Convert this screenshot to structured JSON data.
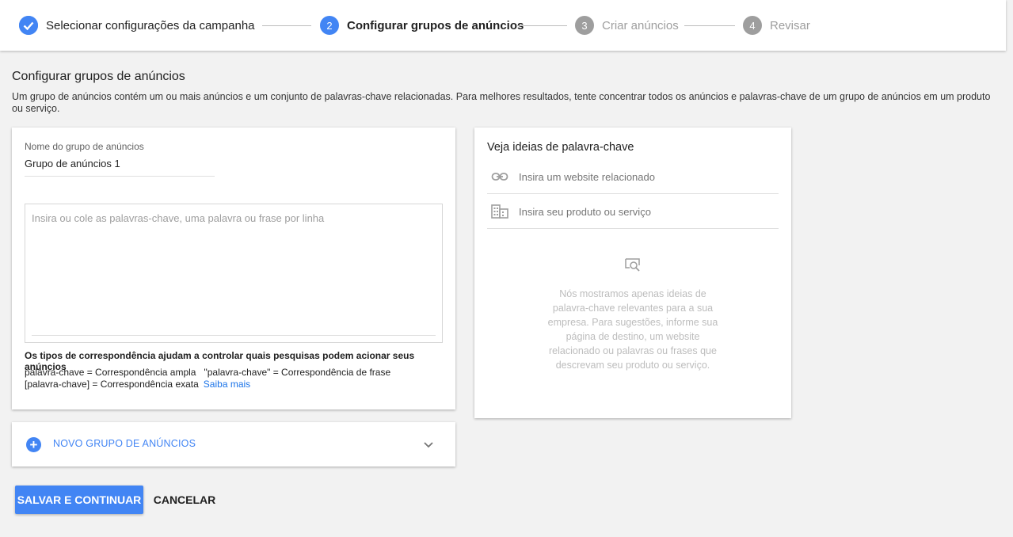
{
  "stepper": {
    "steps": [
      {
        "num": "",
        "label": "Selecionar configurações da campanha",
        "state": "done"
      },
      {
        "num": "2",
        "label": "Configurar grupos de anúncios",
        "state": "active"
      },
      {
        "num": "3",
        "label": "Criar anúncios",
        "state": "todo"
      },
      {
        "num": "4",
        "label": "Revisar",
        "state": "todo"
      }
    ]
  },
  "page": {
    "title": "Configurar grupos de anúncios",
    "description": "Um grupo de anúncios contém um ou mais anúncios e um conjunto de palavras-chave relacionadas. Para melhores resultados, tente concentrar todos os anúncios e palavras-chave de um grupo de anúncios em um produto ou serviço."
  },
  "ad_group": {
    "name_label": "Nome do grupo de anúncios",
    "name_value": "Grupo de anúncios 1",
    "keywords_placeholder": "Insira ou cole as palavras-chave, uma palavra ou frase por linha",
    "match_title": "Os tipos de correspondência ajudam a controlar quais pesquisas podem acionar seus anúncios",
    "match_broad": "palavra-chave = Correspondência ampla",
    "match_phrase": "\"palavra-chave\" = Correspondência de frase",
    "match_exact": "[palavra-chave] = Correspondência exata",
    "learn_more": "Saiba mais"
  },
  "new_group": {
    "label": "NOVO GRUPO DE ANÚNCIOS"
  },
  "ideas": {
    "title": "Veja ideias de palavra-chave",
    "website_placeholder": "Insira um website relacionado",
    "product_placeholder": "Insira seu produto ou serviço",
    "empty_text": "Nós mostramos apenas ideias de palavra-chave relevantes para a sua empresa. Para sugestões, informe sua página de destino, um website relacionado ou palavras ou frases que descrevam seu produto ou serviço."
  },
  "actions": {
    "save": "SALVAR E CONTINUAR",
    "cancel": "CANCELAR"
  },
  "colors": {
    "accent": "#4285f4",
    "inactive_step": "#9e9e9e"
  }
}
